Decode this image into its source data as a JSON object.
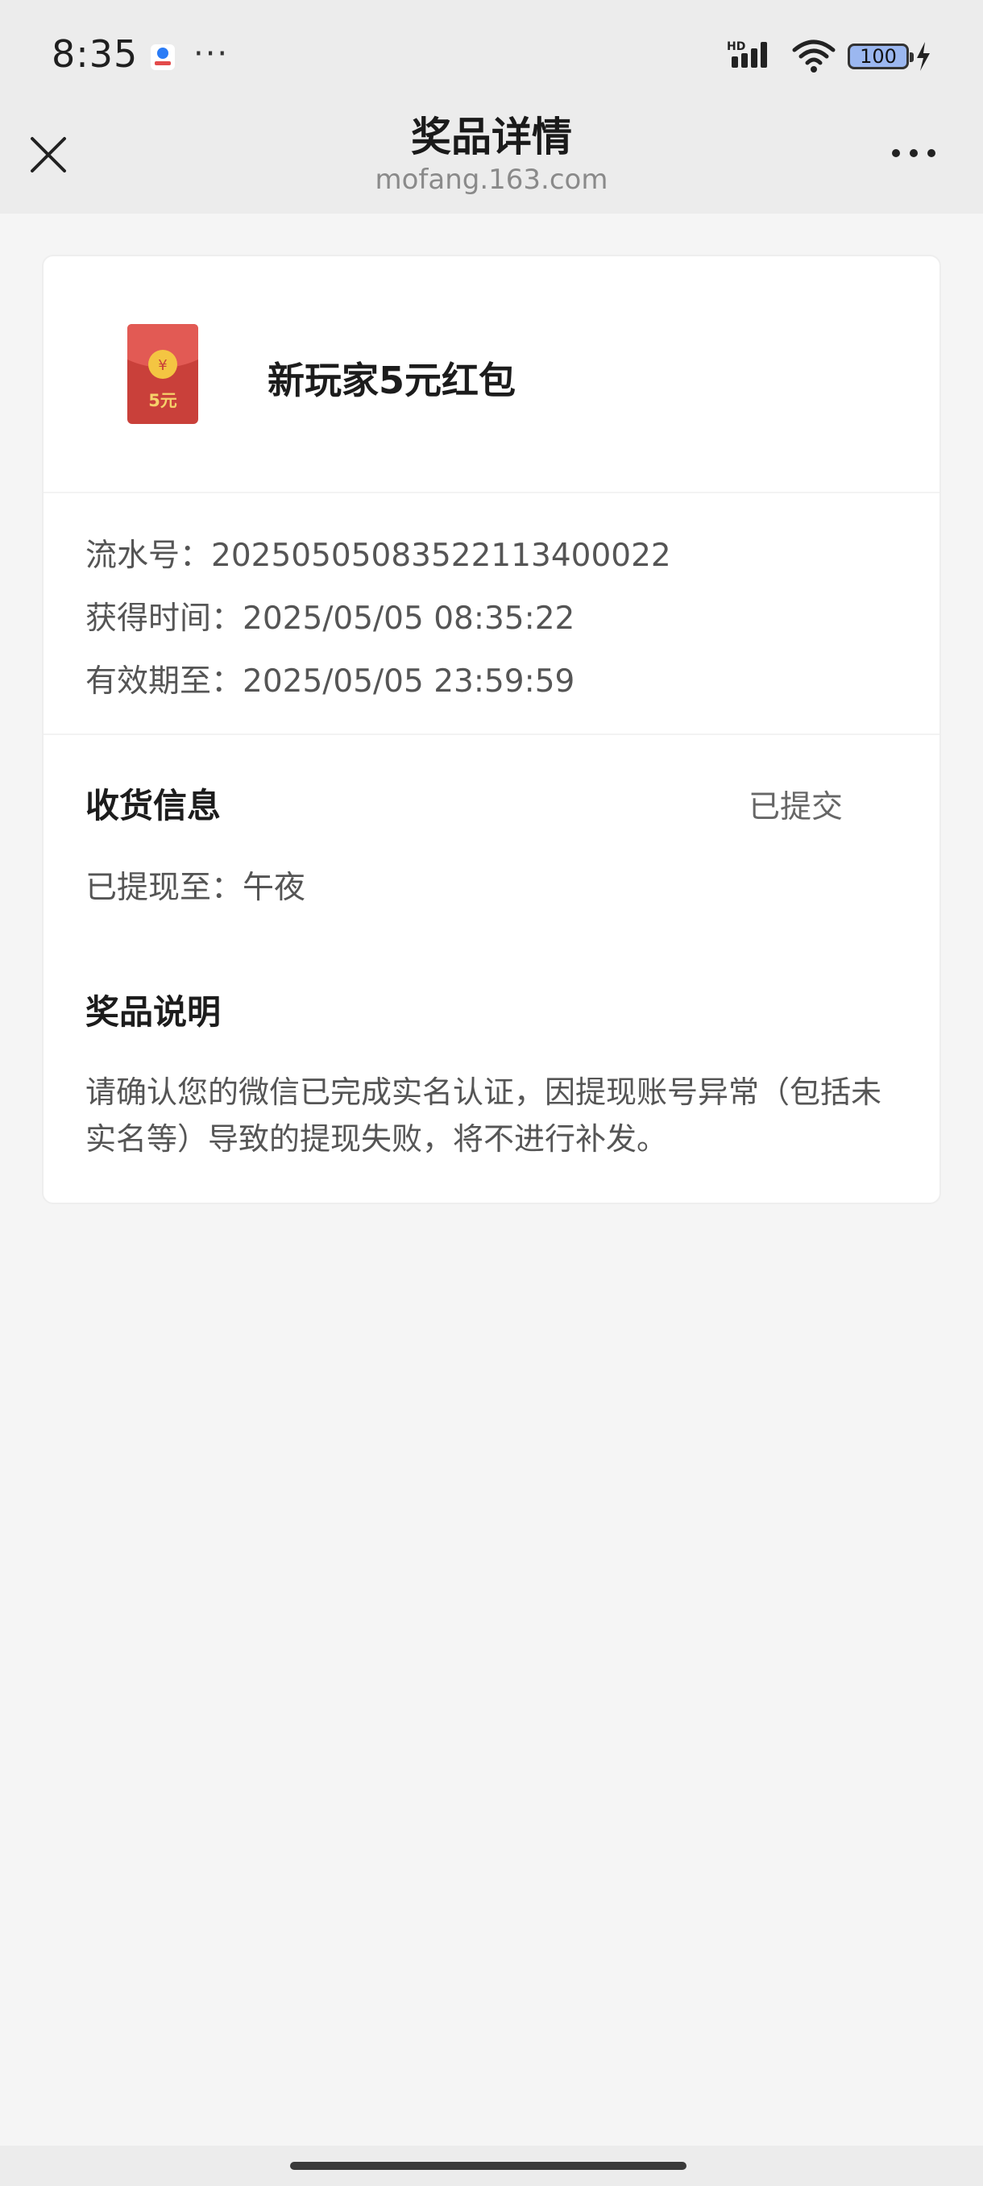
{
  "status_bar": {
    "time": "8:35",
    "dots": "···",
    "battery": "100",
    "icons": [
      "app-notification-icon",
      "hd-signal-icon",
      "wifi-icon",
      "battery-icon",
      "charging-icon"
    ]
  },
  "header": {
    "title": "奖品详情",
    "subtitle": "mofang.163.com",
    "left_icon": "close-icon",
    "right_icon": "more-icon"
  },
  "prize": {
    "name": "新玩家5元红包",
    "envelope_label": "5元",
    "coin_symbol": "¥",
    "envelope_color": "#d9463f"
  },
  "details": [
    {
      "label": "流水号：",
      "value": "2025050508352211340002​2"
    },
    {
      "label": "获得时间：",
      "value": "2025/05/05 08:35:22"
    },
    {
      "label": "有效期至：",
      "value": "2025/05/05 23:59:59"
    }
  ],
  "delivery": {
    "title": "收货信息",
    "status": "已提交",
    "line_label": "已提现至：",
    "line_value": "午夜"
  },
  "description": {
    "title": "奖品说明",
    "text": "请确认您的微信已完成实名认证，因提现账号异常（包括未实名等）导致的提现失败，将不进行补发。"
  }
}
